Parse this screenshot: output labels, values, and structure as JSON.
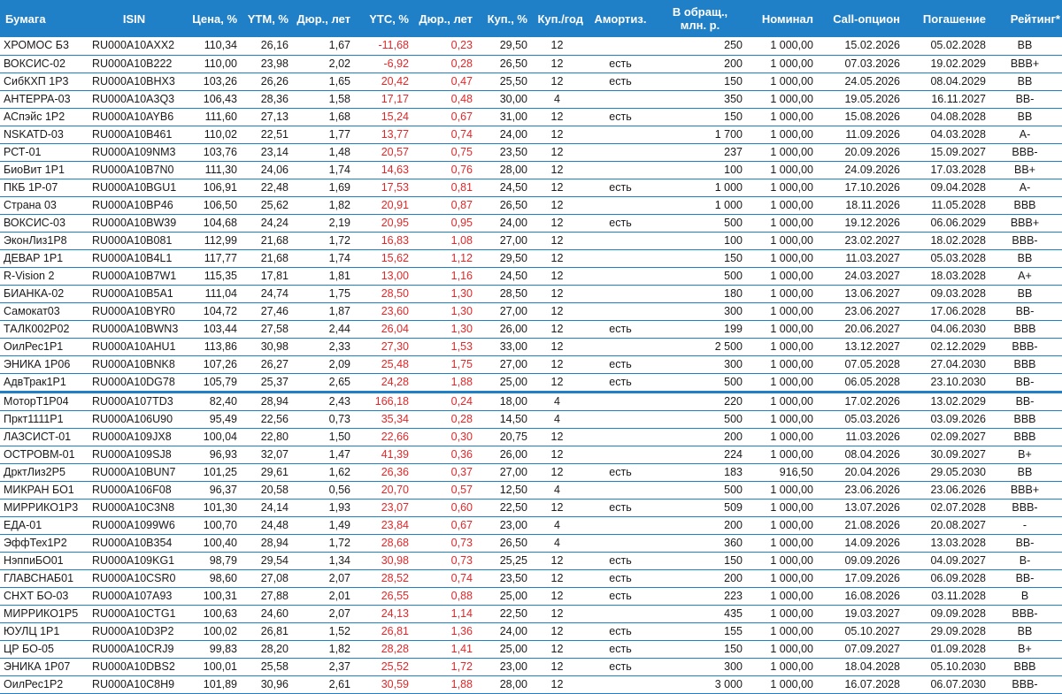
{
  "columns": [
    {
      "key": "name",
      "label": "Бумага"
    },
    {
      "key": "isin",
      "label": "ISIN"
    },
    {
      "key": "price",
      "label": "Цена, %"
    },
    {
      "key": "ytm",
      "label": "YTM, %"
    },
    {
      "key": "dur1",
      "label": "Дюр., лет"
    },
    {
      "key": "ytc",
      "label": "YTC, %"
    },
    {
      "key": "dur2",
      "label": "Дюр., лет"
    },
    {
      "key": "coupon",
      "label": "Куп., %"
    },
    {
      "key": "freq",
      "label": "Куп./год"
    },
    {
      "key": "amort",
      "label": "Амортиз."
    },
    {
      "key": "volume",
      "label": "В обращ., млн. р."
    },
    {
      "key": "nominal",
      "label": "Номинал"
    },
    {
      "key": "call",
      "label": "Call-опцион"
    },
    {
      "key": "maturity",
      "label": "Погашение"
    },
    {
      "key": "rating",
      "label": "Рейтинг*"
    }
  ],
  "rows": [
    [
      "ХРОМОС Б3",
      "RU000A10AXX2",
      "110,34",
      "26,16",
      "1,67",
      "-11,68",
      "0,23",
      "29,50",
      "12",
      "",
      "250",
      "1 000,00",
      "15.02.2026",
      "05.02.2028",
      "BB"
    ],
    [
      "ВОКСИС-02",
      "RU000A10B222",
      "110,00",
      "23,98",
      "2,02",
      "-6,92",
      "0,28",
      "26,50",
      "12",
      "есть",
      "200",
      "1 000,00",
      "07.03.2026",
      "19.02.2029",
      "BBB+"
    ],
    [
      "СибКХП 1Р3",
      "RU000A10BHX3",
      "103,26",
      "26,26",
      "1,65",
      "20,42",
      "0,47",
      "25,50",
      "12",
      "есть",
      "150",
      "1 000,00",
      "24.05.2026",
      "08.04.2029",
      "BB"
    ],
    [
      "АНТЕРРА-03",
      "RU000A10A3Q3",
      "106,43",
      "28,36",
      "1,58",
      "17,17",
      "0,48",
      "30,00",
      "4",
      "",
      "350",
      "1 000,00",
      "19.05.2026",
      "16.11.2027",
      "BB-"
    ],
    [
      "АСпэйс 1Р2",
      "RU000A10AYB6",
      "111,60",
      "27,13",
      "1,68",
      "15,24",
      "0,67",
      "31,00",
      "12",
      "есть",
      "150",
      "1 000,00",
      "15.08.2026",
      "04.08.2028",
      "BB"
    ],
    [
      "NSKATD-03",
      "RU000A10B461",
      "110,02",
      "22,51",
      "1,77",
      "13,77",
      "0,74",
      "24,00",
      "12",
      "",
      "1 700",
      "1 000,00",
      "11.09.2026",
      "04.03.2028",
      "A-"
    ],
    [
      "РСТ-01",
      "RU000A109NM3",
      "103,76",
      "23,14",
      "1,48",
      "20,57",
      "0,75",
      "23,50",
      "12",
      "",
      "237",
      "1 000,00",
      "20.09.2026",
      "15.09.2027",
      "BBB-"
    ],
    [
      "БиоВит 1Р1",
      "RU000A10B7N0",
      "111,30",
      "24,06",
      "1,74",
      "14,63",
      "0,76",
      "28,00",
      "12",
      "",
      "100",
      "1 000,00",
      "24.09.2026",
      "17.03.2028",
      "BB+"
    ],
    [
      "ПКБ 1Р-07",
      "RU000A10BGU1",
      "106,91",
      "22,48",
      "1,69",
      "17,53",
      "0,81",
      "24,50",
      "12",
      "есть",
      "1 000",
      "1 000,00",
      "17.10.2026",
      "09.04.2028",
      "A-"
    ],
    [
      "Страна 03",
      "RU000A10BP46",
      "106,50",
      "25,62",
      "1,82",
      "20,91",
      "0,87",
      "26,50",
      "12",
      "",
      "1 000",
      "1 000,00",
      "18.11.2026",
      "11.05.2028",
      "BBB"
    ],
    [
      "ВОКСИС-03",
      "RU000A10BW39",
      "104,68",
      "24,24",
      "2,19",
      "20,95",
      "0,95",
      "24,00",
      "12",
      "есть",
      "500",
      "1 000,00",
      "19.12.2026",
      "06.06.2029",
      "BBB+"
    ],
    [
      "ЭконЛиз1Р8",
      "RU000A10B081",
      "112,99",
      "21,68",
      "1,72",
      "16,83",
      "1,08",
      "27,00",
      "12",
      "",
      "100",
      "1 000,00",
      "23.02.2027",
      "18.02.2028",
      "BBB-"
    ],
    [
      "ДЕВАР 1Р1",
      "RU000A10B4L1",
      "117,77",
      "21,68",
      "1,74",
      "15,62",
      "1,12",
      "29,50",
      "12",
      "",
      "150",
      "1 000,00",
      "11.03.2027",
      "05.03.2028",
      "BB"
    ],
    [
      "R-Vision 2",
      "RU000A10B7W1",
      "115,35",
      "17,81",
      "1,81",
      "13,00",
      "1,16",
      "24,50",
      "12",
      "",
      "500",
      "1 000,00",
      "24.03.2027",
      "18.03.2028",
      "A+"
    ],
    [
      "БИАНКА-02",
      "RU000A10B5A1",
      "111,04",
      "24,74",
      "1,75",
      "28,50",
      "1,30",
      "28,50",
      "12",
      "",
      "180",
      "1 000,00",
      "13.06.2027",
      "09.03.2028",
      "BB"
    ],
    [
      "Самокат03",
      "RU000A10BYR0",
      "104,72",
      "27,46",
      "1,87",
      "23,60",
      "1,30",
      "27,00",
      "12",
      "",
      "300",
      "1 000,00",
      "23.06.2027",
      "17.06.2028",
      "BB-"
    ],
    [
      "ТАЛК002Р02",
      "RU000A10BWN3",
      "103,44",
      "27,58",
      "2,44",
      "26,04",
      "1,30",
      "26,00",
      "12",
      "есть",
      "199",
      "1 000,00",
      "20.06.2027",
      "04.06.2030",
      "BBB"
    ],
    [
      "ОилРес1Р1",
      "RU000A10AHU1",
      "113,86",
      "30,98",
      "2,33",
      "27,30",
      "1,53",
      "33,00",
      "12",
      "",
      "2 500",
      "1 000,00",
      "13.12.2027",
      "02.12.2029",
      "BBB-"
    ],
    [
      "ЭНИКА 1Р06",
      "RU000A10BNK8",
      "107,26",
      "26,27",
      "2,09",
      "25,48",
      "1,75",
      "27,00",
      "12",
      "есть",
      "300",
      "1 000,00",
      "07.05.2028",
      "27.04.2030",
      "BBB"
    ],
    [
      "АдвТрак1Р1",
      "RU000A10DG78",
      "105,79",
      "25,37",
      "2,65",
      "24,28",
      "1,88",
      "25,00",
      "12",
      "есть",
      "500",
      "1 000,00",
      "06.05.2028",
      "23.10.2030",
      "BB-"
    ],
    [
      "МоторТ1Р04",
      "RU000A107TD3",
      "82,40",
      "28,94",
      "2,43",
      "166,18",
      "0,24",
      "18,00",
      "4",
      "",
      "220",
      "1 000,00",
      "17.02.2026",
      "13.02.2029",
      "BB-"
    ],
    [
      "Пркт1111Р1",
      "RU000A106U90",
      "95,49",
      "22,56",
      "0,73",
      "35,34",
      "0,28",
      "14,50",
      "4",
      "",
      "500",
      "1 000,00",
      "05.03.2026",
      "03.09.2026",
      "BBB"
    ],
    [
      "ЛАЗСИСТ-01",
      "RU000A109JX8",
      "100,04",
      "22,80",
      "1,50",
      "22,66",
      "0,30",
      "20,75",
      "12",
      "",
      "200",
      "1 000,00",
      "11.03.2026",
      "02.09.2027",
      "BBB"
    ],
    [
      "ОСТРОВМ-01",
      "RU000A109SJ8",
      "96,93",
      "32,07",
      "1,47",
      "41,39",
      "0,36",
      "26,00",
      "12",
      "",
      "224",
      "1 000,00",
      "08.04.2026",
      "30.09.2027",
      "B+"
    ],
    [
      "ДрктЛиз2Р5",
      "RU000A10BUN7",
      "101,25",
      "29,61",
      "1,62",
      "26,36",
      "0,37",
      "27,00",
      "12",
      "есть",
      "183",
      "916,50",
      "20.04.2026",
      "29.05.2030",
      "BB"
    ],
    [
      "МИКРАН БО1",
      "RU000A106F08",
      "96,37",
      "20,58",
      "0,56",
      "20,70",
      "0,57",
      "12,50",
      "4",
      "",
      "500",
      "1 000,00",
      "23.06.2026",
      "23.06.2026",
      "BBB+"
    ],
    [
      "МИРРИКО1Р3",
      "RU000A10C3N8",
      "101,30",
      "24,14",
      "1,93",
      "23,07",
      "0,60",
      "22,50",
      "12",
      "есть",
      "509",
      "1 000,00",
      "13.07.2026",
      "02.07.2028",
      "BBB-"
    ],
    [
      "ЕДА-01",
      "RU000A1099W6",
      "100,70",
      "24,48",
      "1,49",
      "23,84",
      "0,67",
      "23,00",
      "4",
      "",
      "200",
      "1 000,00",
      "21.08.2026",
      "20.08.2027",
      "-"
    ],
    [
      "ЭффТех1Р2",
      "RU000A10B354",
      "100,40",
      "28,94",
      "1,72",
      "28,68",
      "0,73",
      "26,50",
      "4",
      "",
      "360",
      "1 000,00",
      "14.09.2026",
      "13.03.2028",
      "BB-"
    ],
    [
      "НэппиБО01",
      "RU000A109KG1",
      "98,79",
      "29,54",
      "1,34",
      "30,98",
      "0,73",
      "25,25",
      "12",
      "есть",
      "150",
      "1 000,00",
      "09.09.2026",
      "04.09.2027",
      "B-"
    ],
    [
      "ГЛАВСНАБ01",
      "RU000A10CSR0",
      "98,60",
      "27,08",
      "2,07",
      "28,52",
      "0,74",
      "23,50",
      "12",
      "есть",
      "200",
      "1 000,00",
      "17.09.2026",
      "06.09.2028",
      "BB-"
    ],
    [
      "СНХТ БО-03",
      "RU000A107A93",
      "100,31",
      "27,88",
      "2,01",
      "26,55",
      "0,88",
      "25,00",
      "12",
      "есть",
      "223",
      "1 000,00",
      "16.08.2026",
      "03.11.2028",
      "B"
    ],
    [
      "МИРРИКО1Р5",
      "RU000A10CTG1",
      "100,63",
      "24,60",
      "2,07",
      "24,13",
      "1,14",
      "22,50",
      "12",
      "",
      "435",
      "1 000,00",
      "19.03.2027",
      "09.09.2028",
      "BBB-"
    ],
    [
      "ЮУЛЦ 1Р1",
      "RU000A10D3P2",
      "100,02",
      "26,81",
      "1,52",
      "26,81",
      "1,36",
      "24,00",
      "12",
      "есть",
      "155",
      "1 000,00",
      "05.10.2027",
      "29.09.2028",
      "BB"
    ],
    [
      "ЦР БО-05",
      "RU000A10CRJ9",
      "99,83",
      "28,20",
      "1,82",
      "28,28",
      "1,41",
      "25,00",
      "12",
      "есть",
      "150",
      "1 000,00",
      "07.09.2027",
      "01.09.2028",
      "B+"
    ],
    [
      "ЭНИКА 1Р07",
      "RU000A10DBS2",
      "100,01",
      "25,58",
      "2,37",
      "25,52",
      "1,72",
      "23,00",
      "12",
      "есть",
      "300",
      "1 000,00",
      "18.04.2028",
      "05.10.2030",
      "BBB"
    ],
    [
      "ОилРес1Р2",
      "RU000A10C8H9",
      "101,89",
      "30,96",
      "2,61",
      "30,59",
      "1,88",
      "28,00",
      "12",
      "",
      "3 000",
      "1 000,00",
      "16.07.2028",
      "06.07.2030",
      "BBB-"
    ]
  ],
  "group_break_after_row": 19,
  "colors": {
    "header_bg": "#1f7fc7",
    "header_text": "#ffffff",
    "negative_highlight": "#e0282a",
    "row_border": "#1f7fc7"
  }
}
